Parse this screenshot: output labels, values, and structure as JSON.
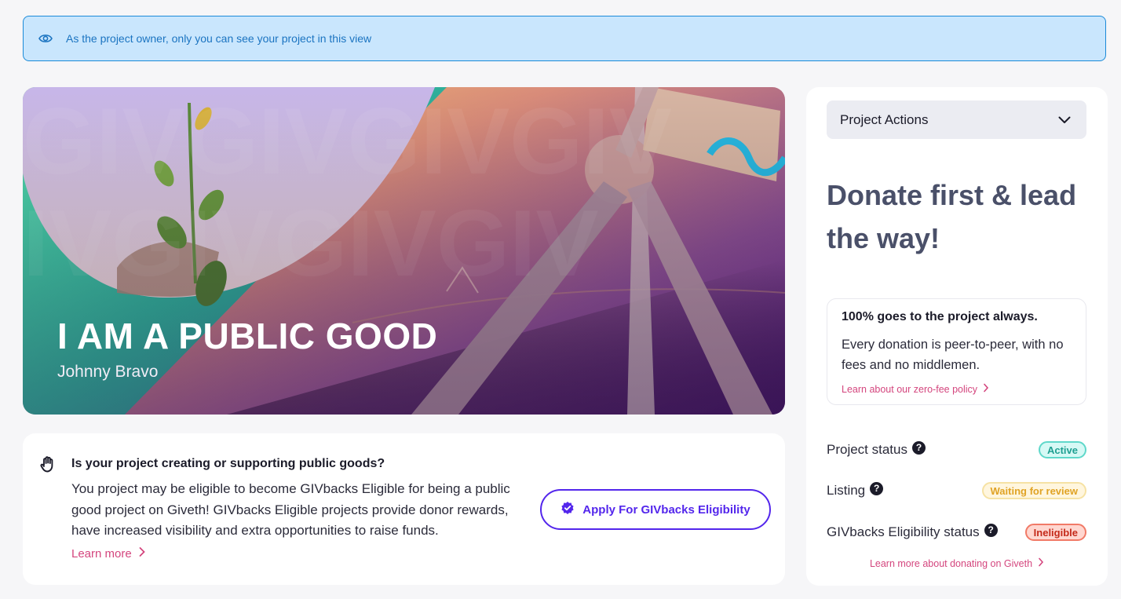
{
  "notice": {
    "text": "As the project owner, only you can see your project in this view",
    "icon": "eye-icon"
  },
  "hero": {
    "title": "I AM A PUBLIC GOOD",
    "author": "Johnny Bravo"
  },
  "public_goods": {
    "question": "Is your project creating or supporting public goods?",
    "description": "You project may be eligible to become GIVbacks Eligible for being a public good project on Giveth! GIVbacks Eligible projects provide donor rewards, have increased visibility and extra opportunities to raise funds.",
    "learn_more": "Learn more",
    "apply_button": "Apply For GIVbacks Eligibility"
  },
  "sidebar": {
    "project_actions": "Project Actions",
    "donate_heading": "Donate first & lead the way!",
    "info": {
      "bold": "100% goes to the project always.",
      "text": "Every donation is peer-to-peer, with no fees and no middlemen.",
      "link": "Learn about our zero-fee policy"
    },
    "statuses": [
      {
        "label": "Project status",
        "badge": "Active",
        "kind": "active"
      },
      {
        "label": "Listing",
        "badge": "Waiting for review",
        "kind": "waiting"
      },
      {
        "label": "GIVbacks Eligibility status",
        "badge": "Ineligible",
        "kind": "ineligible"
      }
    ],
    "learn_more": "Learn more about donating on Giveth"
  },
  "colors": {
    "accent": "#5326ec",
    "link": "#d4467e",
    "notice_bg": "#c9e6fd",
    "heading": "#4a5069"
  }
}
